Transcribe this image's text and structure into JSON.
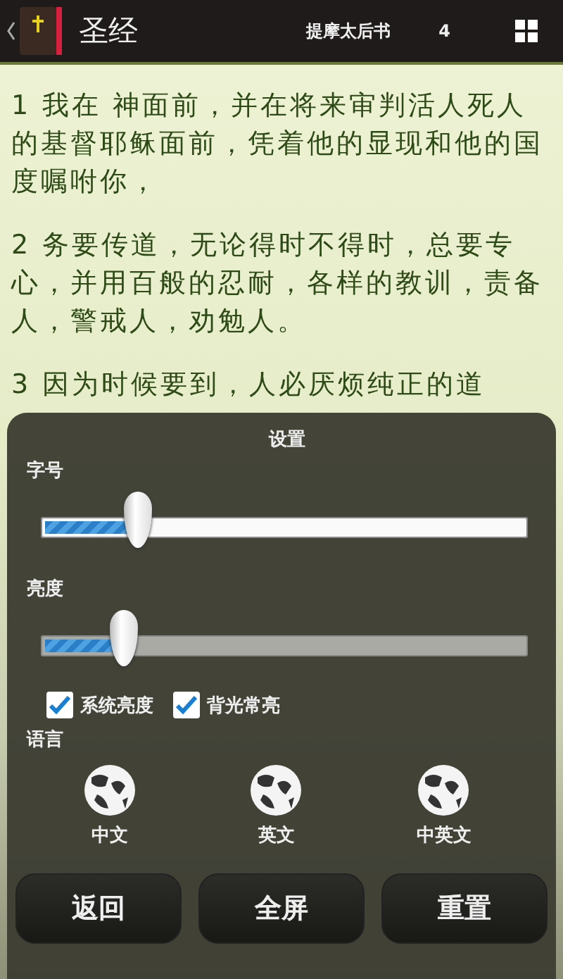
{
  "header": {
    "title": "圣经",
    "book": "提摩太后书",
    "chapter": "4"
  },
  "verses": [
    "1 我在  神面前，并在将来审判活人死人的基督耶稣面前，凭着他的显现和他的国度嘱咐你，",
    "2 务要传道，无论得时不得时，总要专心，并用百般的忍耐，各样的教训，责备人，警戒人，劝勉人。",
    "3 因为时候要到，人必厌烦纯正的道"
  ],
  "settings": {
    "title": "设置",
    "sliders": [
      {
        "label": "字号",
        "level": 0.2,
        "disabled": false
      },
      {
        "label": "亮度",
        "level": 0.17,
        "disabled": true
      }
    ],
    "checkboxes": [
      {
        "label": "系统亮度",
        "checked": true
      },
      {
        "label": "背光常亮",
        "checked": true
      }
    ],
    "language_label": "语言",
    "languages": [
      {
        "label": "中文"
      },
      {
        "label": "英文"
      },
      {
        "label": "中英文"
      }
    ],
    "buttons": [
      "返回",
      "全屏",
      "重置"
    ]
  }
}
